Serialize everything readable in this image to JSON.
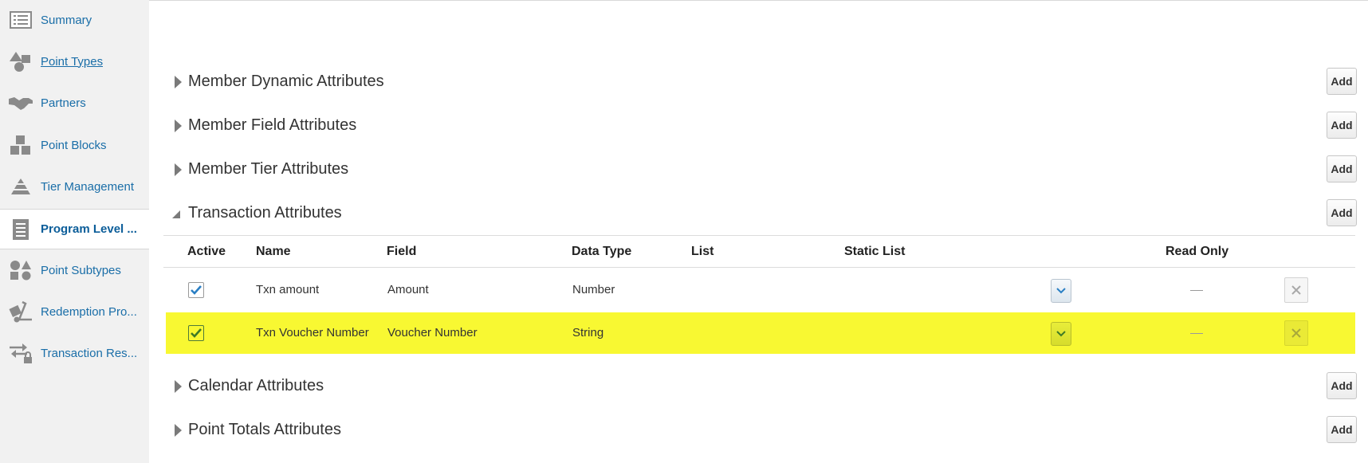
{
  "sidebar": {
    "items": [
      {
        "label": "Summary",
        "icon": "summary-list-icon"
      },
      {
        "label": "Point Types",
        "icon": "point-types-shapes-icon"
      },
      {
        "label": "Partners",
        "icon": "handshake-icon"
      },
      {
        "label": "Point Blocks",
        "icon": "blocks-icon"
      },
      {
        "label": "Tier Management",
        "icon": "pyramid-icon"
      },
      {
        "label": "Program Level ...",
        "icon": "document-lines-icon",
        "active": true
      },
      {
        "label": "Point Subtypes",
        "icon": "point-subtypes-shapes-icon"
      },
      {
        "label": "Redemption Pro...",
        "icon": "hand-truck-icon"
      },
      {
        "label": "Transaction Res...",
        "icon": "exchange-lock-icon"
      }
    ]
  },
  "sections": {
    "member_dynamic": {
      "title": "Member Dynamic Attributes",
      "add_label": "Add"
    },
    "member_field": {
      "title": "Member Field Attributes",
      "add_label": "Add"
    },
    "member_tier": {
      "title": "Member Tier Attributes",
      "add_label": "Add"
    },
    "transaction": {
      "title": "Transaction Attributes",
      "add_label": "Add"
    },
    "calendar": {
      "title": "Calendar Attributes",
      "add_label": "Add"
    },
    "point_totals": {
      "title": "Point Totals Attributes",
      "add_label": "Add"
    }
  },
  "transaction_table": {
    "columns": {
      "active": "Active",
      "name": "Name",
      "field": "Field",
      "data_type": "Data Type",
      "list": "List",
      "static_list": "Static List",
      "read_only": "Read Only"
    },
    "rows": [
      {
        "active": true,
        "name": "Txn amount",
        "field": "Amount",
        "data_type": "Number",
        "read_only": "—"
      },
      {
        "active": true,
        "name": "Txn Voucher Number",
        "field": "Voucher Number",
        "data_type": "String",
        "read_only": "—",
        "highlighted": true
      }
    ]
  },
  "colors": {
    "link": "#1a6ea8",
    "highlight": "#f8f832",
    "sidebar_bg": "#f1f1f1"
  }
}
